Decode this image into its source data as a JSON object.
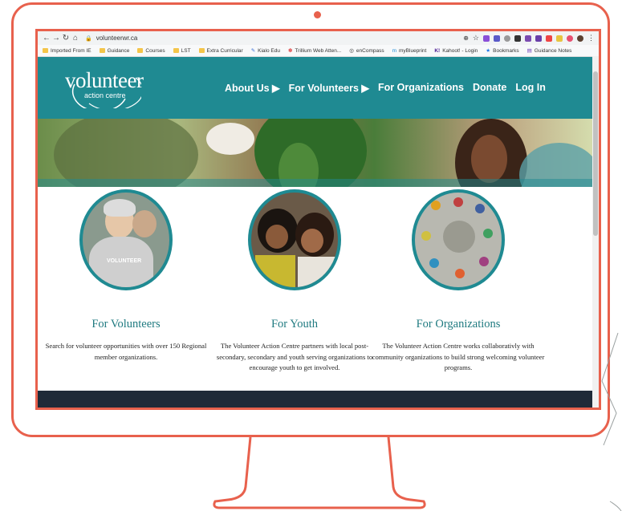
{
  "browser": {
    "url": "volunteerwr.ca",
    "bookmarks": [
      "Imported From IE",
      "Guidance",
      "Courses",
      "LST",
      "Extra Curricular",
      "Kialo Edu",
      "Trillium Web Atten...",
      "enCompass",
      "myBlueprint",
      "Kahoot! - Login",
      "Bookmarks",
      "Guidance Notes"
    ]
  },
  "site": {
    "logo_word": "volunteer",
    "logo_sub": "action centre",
    "nav": [
      "About Us ▶",
      "For Volunteers ▶",
      "For Organizations",
      "Donate",
      "Log In"
    ]
  },
  "cards": [
    {
      "title": "For Volunteers",
      "text": "Search for volunteer opportunities with over 150 Regional member organizations.",
      "shirt_text": "VOLUNTEER"
    },
    {
      "title": "For Youth",
      "text": "The Volunteer Action Centre partners with local post-secondary, secondary and youth serving organizations to encourage youth to get involved."
    },
    {
      "title": "For Organizations",
      "text": "The Volunteer Action Centre works collaborativly with community organizations to build strong welcoming volunteer programs."
    }
  ],
  "colors": {
    "frame": "#e8614d",
    "teal": "#1f8a92"
  }
}
